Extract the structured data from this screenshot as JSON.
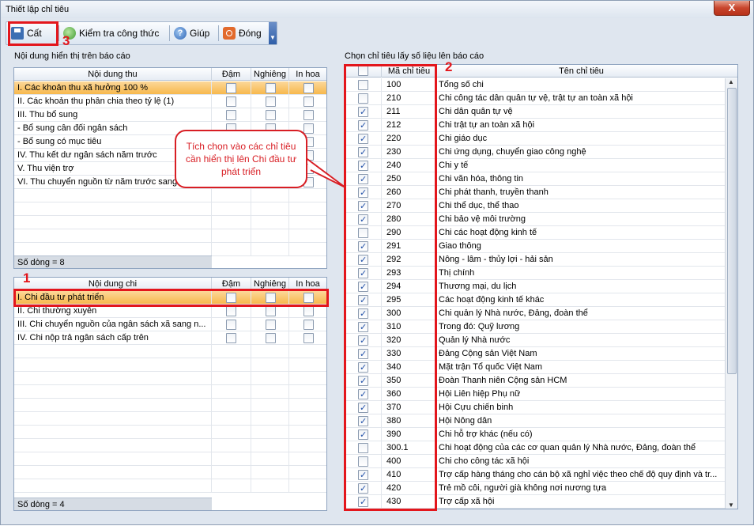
{
  "window": {
    "title": "Thiết lập chỉ tiêu",
    "close_label": "X"
  },
  "toolbar": {
    "save_label": "Cất",
    "check_label": "Kiểm tra công thức",
    "help_label": "Giúp",
    "close_label": "Đóng",
    "help_glyph": "?"
  },
  "top_panel": {
    "label": "Nội dung hiển thị trên báo cáo",
    "headers": [
      "Nội dung thu",
      "Đậm",
      "Nghiêng",
      "In hoa"
    ],
    "rows": [
      "I. Các khoản thu xã hưởng 100 %",
      "II. Các khoản thu phân chia theo tỷ lệ (1)",
      "III. Thu bổ sung",
      "- Bổ sung cân đối ngân sách",
      "- Bổ sung có mục tiêu",
      "IV. Thu kết dư ngân sách năm trước",
      "V. Thu viện trợ",
      "VI. Thu chuyển nguồn từ năm trước sang"
    ],
    "footer": "Số dòng = 8"
  },
  "bottom_panel": {
    "headers": [
      "Nội dung chi",
      "Đậm",
      "Nghiêng",
      "In hoa"
    ],
    "rows": [
      "I. Chi đầu tư phát triển",
      "II. Chi thường xuyên",
      "III. Chi chuyển nguồn của ngân sách xã sang n...",
      "IV. Chi nộp trả ngân sách cấp trên"
    ],
    "footer": "Số dòng = 4"
  },
  "right_panel": {
    "label": "Chọn chỉ tiêu lấy số liệu lên báo cáo",
    "headers": [
      "Mã chỉ tiêu",
      "Tên chỉ tiêu"
    ],
    "rows": [
      {
        "code": "100",
        "name": "Tổng số chi",
        "checked": false
      },
      {
        "code": "210",
        "name": "Chi công tác dân quân tự vệ, trật tự an toàn xã hội",
        "checked": false
      },
      {
        "code": "211",
        "name": "Chi dân quân tự vệ",
        "checked": true
      },
      {
        "code": "212",
        "name": "Chi trật tự an toàn xã hội",
        "checked": true
      },
      {
        "code": "220",
        "name": "Chi giáo dục",
        "checked": true
      },
      {
        "code": "230",
        "name": "Chi ứng dụng, chuyển giao công nghệ",
        "checked": true
      },
      {
        "code": "240",
        "name": "Chi y tế",
        "checked": true
      },
      {
        "code": "250",
        "name": "Chi văn hóa, thông tin",
        "checked": true
      },
      {
        "code": "260",
        "name": "Chi phát thanh, truyền thanh",
        "checked": true
      },
      {
        "code": "270",
        "name": "Chi thể dục, thể thao",
        "checked": true
      },
      {
        "code": "280",
        "name": "Chi bảo vệ môi trường",
        "checked": true
      },
      {
        "code": "290",
        "name": "Chi các hoạt động kinh tế",
        "checked": false
      },
      {
        "code": "291",
        "name": "Giao thông",
        "checked": true
      },
      {
        "code": "292",
        "name": "Nông - lâm - thủy lợi - hải sản",
        "checked": true
      },
      {
        "code": "293",
        "name": "Thị chính",
        "checked": true
      },
      {
        "code": "294",
        "name": "Thương mại, du lịch",
        "checked": true
      },
      {
        "code": "295",
        "name": "Các hoạt động kinh tế khác",
        "checked": true
      },
      {
        "code": "300",
        "name": "Chi quản lý Nhà nước, Đảng, đoàn thể",
        "checked": true
      },
      {
        "code": "310",
        "name": "Trong đó: Quỹ lương",
        "checked": true
      },
      {
        "code": "320",
        "name": "Quản lý Nhà nước",
        "checked": true
      },
      {
        "code": "330",
        "name": "Đảng Cộng sản Việt Nam",
        "checked": true
      },
      {
        "code": "340",
        "name": "Mặt trận Tổ quốc Việt Nam",
        "checked": true
      },
      {
        "code": "350",
        "name": "Đoàn Thanh niên Cộng sản HCM",
        "checked": true
      },
      {
        "code": "360",
        "name": "Hội Liên hiệp Phụ nữ",
        "checked": true
      },
      {
        "code": "370",
        "name": "Hội Cựu chiến binh",
        "checked": true
      },
      {
        "code": "380",
        "name": "Hội Nông dân",
        "checked": true
      },
      {
        "code": "390",
        "name": "Chi hỗ trợ khác (nếu có)",
        "checked": true
      },
      {
        "code": "300.1",
        "name": "Chi hoạt động của các cơ quan quản lý Nhà nước, Đảng, đoàn thể",
        "checked": false
      },
      {
        "code": "400",
        "name": "Chi cho công tác xã hội",
        "checked": false
      },
      {
        "code": "410",
        "name": "Trợ cấp hàng tháng cho cán bộ xã nghỉ việc theo chế độ quy định và tr...",
        "checked": true
      },
      {
        "code": "420",
        "name": "Trẻ mồ côi, người già không nơi nương tựa",
        "checked": true
      },
      {
        "code": "430",
        "name": "Trợ cấp xã hội",
        "checked": true
      }
    ]
  },
  "annotations": {
    "callout_text": "Tích chọn vào các chỉ tiêu cần hiển thị lên Chi đầu tư phát triển",
    "num1": "1",
    "num2": "2",
    "num3": "3",
    "red": "#e3161c"
  }
}
